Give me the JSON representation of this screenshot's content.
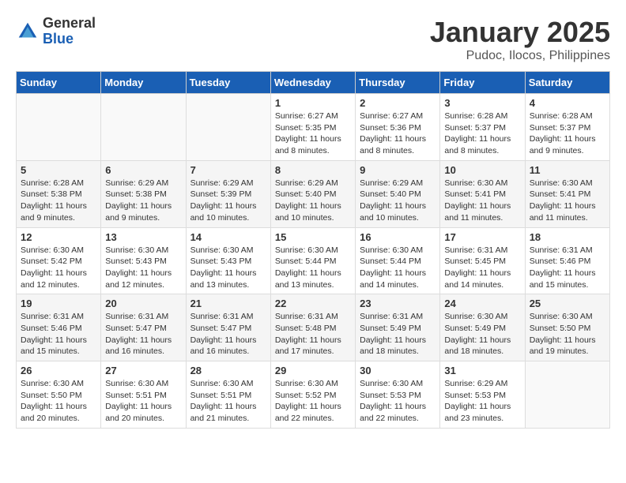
{
  "header": {
    "logo_general": "General",
    "logo_blue": "Blue",
    "month": "January 2025",
    "location": "Pudoc, Ilocos, Philippines"
  },
  "days_of_week": [
    "Sunday",
    "Monday",
    "Tuesday",
    "Wednesday",
    "Thursday",
    "Friday",
    "Saturday"
  ],
  "weeks": [
    [
      {
        "day": "",
        "sunrise": "",
        "sunset": "",
        "daylight": ""
      },
      {
        "day": "",
        "sunrise": "",
        "sunset": "",
        "daylight": ""
      },
      {
        "day": "",
        "sunrise": "",
        "sunset": "",
        "daylight": ""
      },
      {
        "day": "1",
        "sunrise": "6:27 AM",
        "sunset": "5:35 PM",
        "daylight": "11 hours and 8 minutes."
      },
      {
        "day": "2",
        "sunrise": "6:27 AM",
        "sunset": "5:36 PM",
        "daylight": "11 hours and 8 minutes."
      },
      {
        "day": "3",
        "sunrise": "6:28 AM",
        "sunset": "5:37 PM",
        "daylight": "11 hours and 8 minutes."
      },
      {
        "day": "4",
        "sunrise": "6:28 AM",
        "sunset": "5:37 PM",
        "daylight": "11 hours and 9 minutes."
      }
    ],
    [
      {
        "day": "5",
        "sunrise": "6:28 AM",
        "sunset": "5:38 PM",
        "daylight": "11 hours and 9 minutes."
      },
      {
        "day": "6",
        "sunrise": "6:29 AM",
        "sunset": "5:38 PM",
        "daylight": "11 hours and 9 minutes."
      },
      {
        "day": "7",
        "sunrise": "6:29 AM",
        "sunset": "5:39 PM",
        "daylight": "11 hours and 10 minutes."
      },
      {
        "day": "8",
        "sunrise": "6:29 AM",
        "sunset": "5:40 PM",
        "daylight": "11 hours and 10 minutes."
      },
      {
        "day": "9",
        "sunrise": "6:29 AM",
        "sunset": "5:40 PM",
        "daylight": "11 hours and 10 minutes."
      },
      {
        "day": "10",
        "sunrise": "6:30 AM",
        "sunset": "5:41 PM",
        "daylight": "11 hours and 11 minutes."
      },
      {
        "day": "11",
        "sunrise": "6:30 AM",
        "sunset": "5:41 PM",
        "daylight": "11 hours and 11 minutes."
      }
    ],
    [
      {
        "day": "12",
        "sunrise": "6:30 AM",
        "sunset": "5:42 PM",
        "daylight": "11 hours and 12 minutes."
      },
      {
        "day": "13",
        "sunrise": "6:30 AM",
        "sunset": "5:43 PM",
        "daylight": "11 hours and 12 minutes."
      },
      {
        "day": "14",
        "sunrise": "6:30 AM",
        "sunset": "5:43 PM",
        "daylight": "11 hours and 13 minutes."
      },
      {
        "day": "15",
        "sunrise": "6:30 AM",
        "sunset": "5:44 PM",
        "daylight": "11 hours and 13 minutes."
      },
      {
        "day": "16",
        "sunrise": "6:30 AM",
        "sunset": "5:44 PM",
        "daylight": "11 hours and 14 minutes."
      },
      {
        "day": "17",
        "sunrise": "6:31 AM",
        "sunset": "5:45 PM",
        "daylight": "11 hours and 14 minutes."
      },
      {
        "day": "18",
        "sunrise": "6:31 AM",
        "sunset": "5:46 PM",
        "daylight": "11 hours and 15 minutes."
      }
    ],
    [
      {
        "day": "19",
        "sunrise": "6:31 AM",
        "sunset": "5:46 PM",
        "daylight": "11 hours and 15 minutes."
      },
      {
        "day": "20",
        "sunrise": "6:31 AM",
        "sunset": "5:47 PM",
        "daylight": "11 hours and 16 minutes."
      },
      {
        "day": "21",
        "sunrise": "6:31 AM",
        "sunset": "5:47 PM",
        "daylight": "11 hours and 16 minutes."
      },
      {
        "day": "22",
        "sunrise": "6:31 AM",
        "sunset": "5:48 PM",
        "daylight": "11 hours and 17 minutes."
      },
      {
        "day": "23",
        "sunrise": "6:31 AM",
        "sunset": "5:49 PM",
        "daylight": "11 hours and 18 minutes."
      },
      {
        "day": "24",
        "sunrise": "6:30 AM",
        "sunset": "5:49 PM",
        "daylight": "11 hours and 18 minutes."
      },
      {
        "day": "25",
        "sunrise": "6:30 AM",
        "sunset": "5:50 PM",
        "daylight": "11 hours and 19 minutes."
      }
    ],
    [
      {
        "day": "26",
        "sunrise": "6:30 AM",
        "sunset": "5:50 PM",
        "daylight": "11 hours and 20 minutes."
      },
      {
        "day": "27",
        "sunrise": "6:30 AM",
        "sunset": "5:51 PM",
        "daylight": "11 hours and 20 minutes."
      },
      {
        "day": "28",
        "sunrise": "6:30 AM",
        "sunset": "5:51 PM",
        "daylight": "11 hours and 21 minutes."
      },
      {
        "day": "29",
        "sunrise": "6:30 AM",
        "sunset": "5:52 PM",
        "daylight": "11 hours and 22 minutes."
      },
      {
        "day": "30",
        "sunrise": "6:30 AM",
        "sunset": "5:53 PM",
        "daylight": "11 hours and 22 minutes."
      },
      {
        "day": "31",
        "sunrise": "6:29 AM",
        "sunset": "5:53 PM",
        "daylight": "11 hours and 23 minutes."
      },
      {
        "day": "",
        "sunrise": "",
        "sunset": "",
        "daylight": ""
      }
    ]
  ],
  "labels": {
    "sunrise": "Sunrise:",
    "sunset": "Sunset:",
    "daylight": "Daylight:"
  }
}
